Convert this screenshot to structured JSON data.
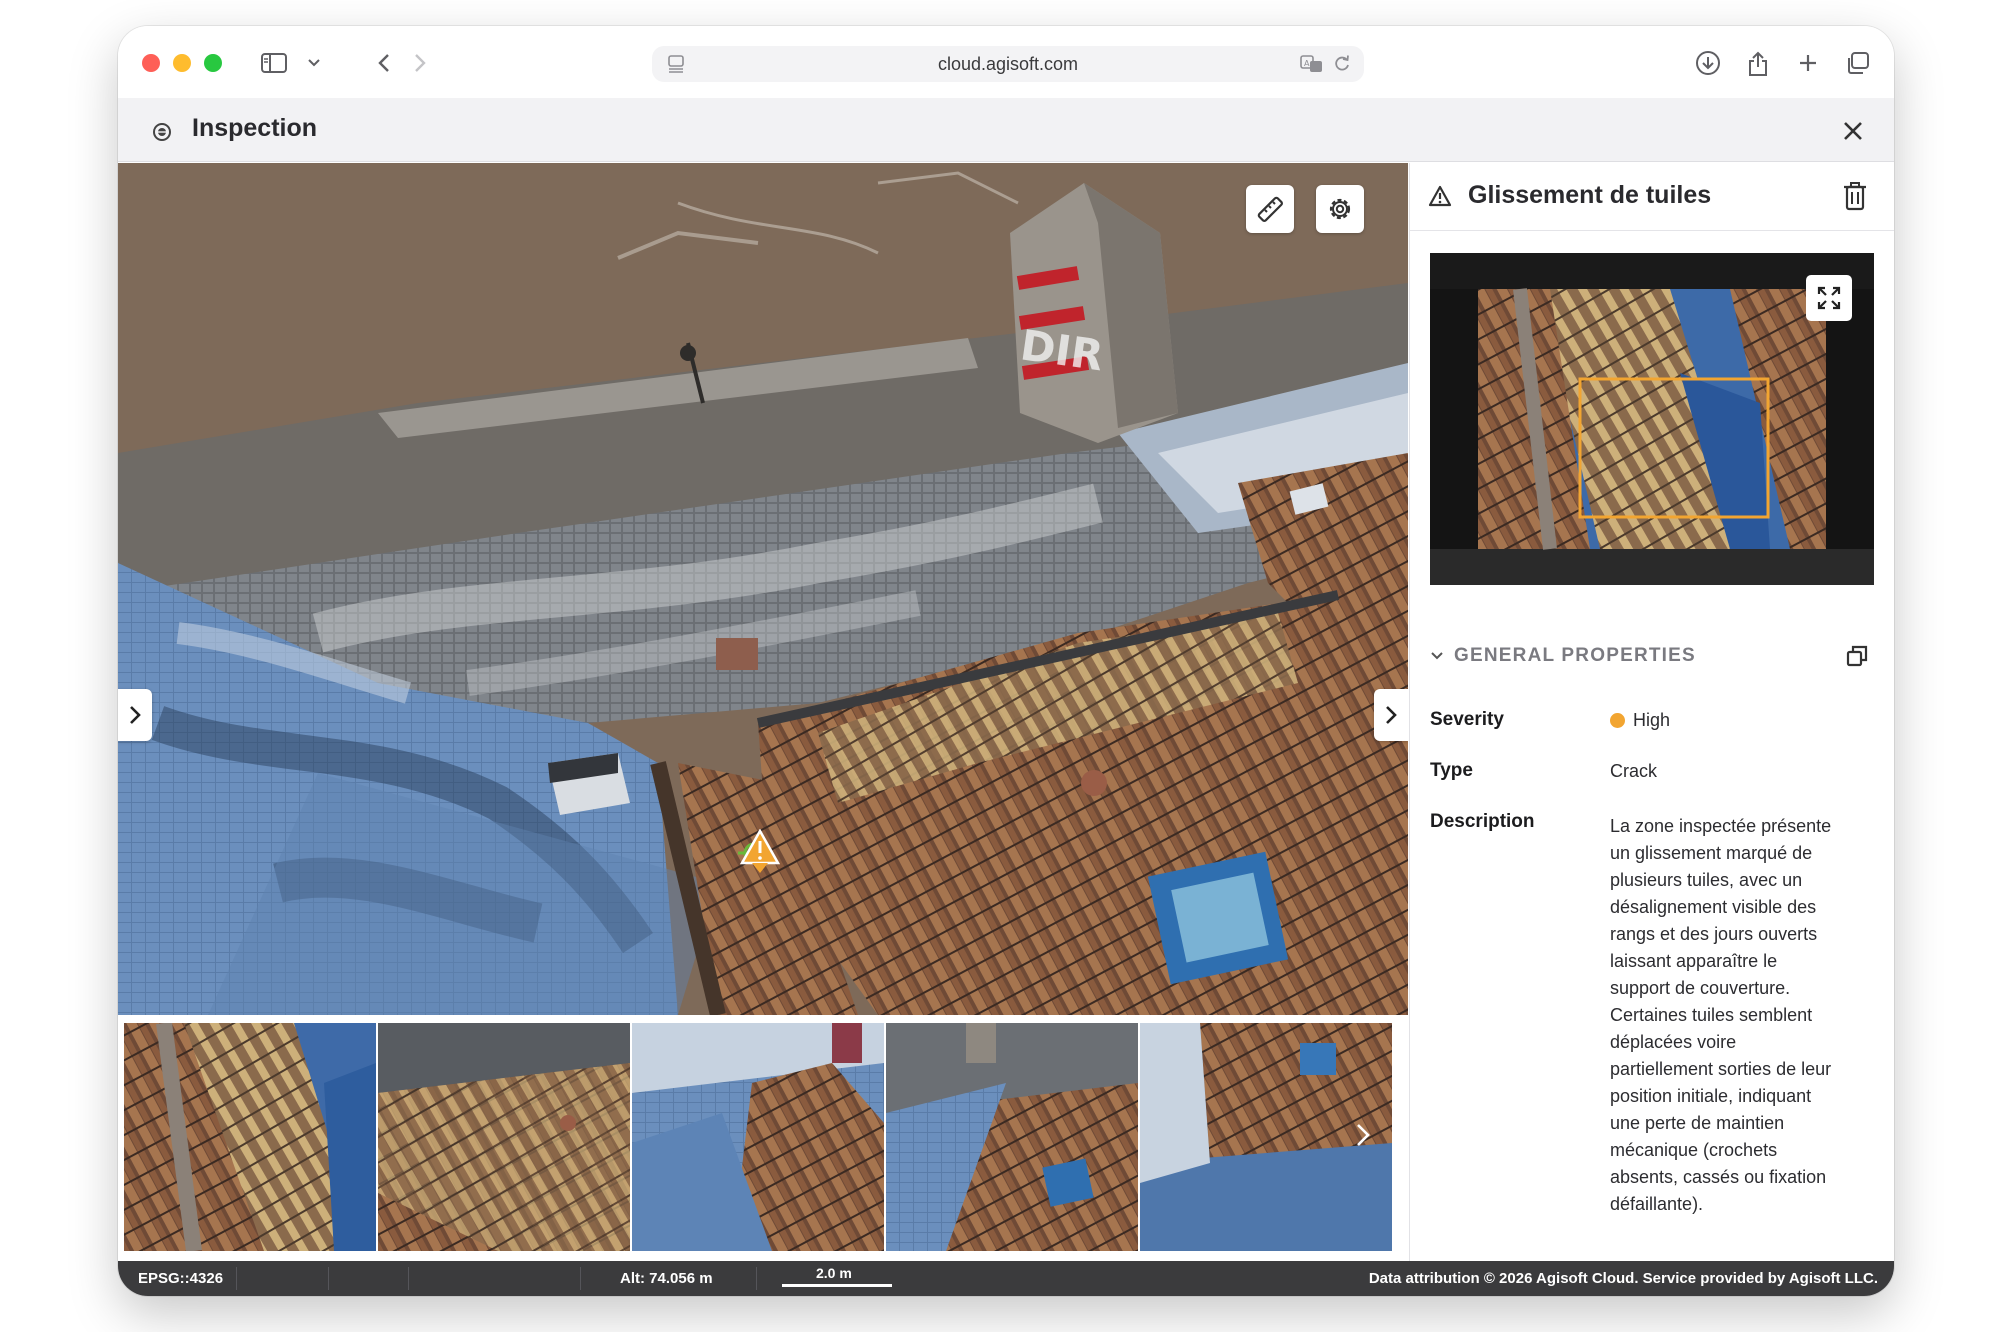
{
  "browser": {
    "url": "cloud.agisoft.com",
    "icons": [
      "sidebar-icon",
      "chevron-down-icon",
      "back-icon",
      "forward-icon",
      "page-icon",
      "translate-icon",
      "reload-icon",
      "download-icon",
      "share-icon",
      "plus-icon",
      "tabs-icon"
    ]
  },
  "app": {
    "title": "Inspection"
  },
  "viewer": {
    "tools": [
      "ruler-icon",
      "gear-icon"
    ],
    "marker": "warning-marker-icon"
  },
  "thumbnails": {
    "count": 5
  },
  "panel": {
    "title": "Glissement de tuiles",
    "section_label": "GENERAL PROPERTIES",
    "properties": {
      "severity_label": "Severity",
      "severity_value": "High",
      "severity_color": "#f2a531",
      "type_label": "Type",
      "type_value": "Crack",
      "description_label": "Description",
      "description_value": "La zone inspectée présente un glissement marqué de plusieurs tuiles, avec un désalignement visible des rangs et des jours ouverts laissant apparaître le support de couverture. Certaines tuiles semblent déplacées voire partiellement sorties de leur position initiale, indiquant une perte de maintien mécanique (crochets absents, cassés ou fixation défaillante)."
    }
  },
  "statusbar": {
    "crs": "EPSG::4326",
    "altitude": "Alt: 74.056 m",
    "scale": "2.0 m",
    "attribution": "Data attribution © 2026 Agisoft Cloud. Service provided by Agisoft LLC."
  },
  "colors": {
    "accent_orange": "#f2a531",
    "statusbar_bg": "#3b3b3d"
  }
}
